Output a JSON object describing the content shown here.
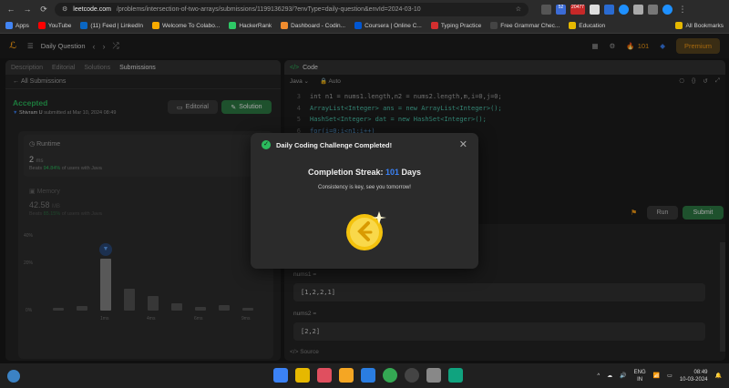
{
  "browser": {
    "url_host": "leetcode.com",
    "url_path": "/problems/intersection-of-two-arrays/submissions/1199136293/?envType=daily-question&envId=2024-03-10",
    "bookmarks": [
      {
        "label": "Apps",
        "color": "#4285f4"
      },
      {
        "label": "YouTube",
        "color": "#ff0000"
      },
      {
        "label": "(11) Feed | LinkedIn",
        "color": "#0a66c2"
      },
      {
        "label": "Welcome To Colabo...",
        "color": "#f9ab00"
      },
      {
        "label": "HackerRank",
        "color": "#2ec866"
      },
      {
        "label": "Dashboard - Codin...",
        "color": "#f08c2e"
      },
      {
        "label": "Coursera | Online C...",
        "color": "#0056d2"
      },
      {
        "label": "Typing Practice",
        "color": "#d32f2f"
      },
      {
        "label": "Free Grammar Chec...",
        "color": "#444444"
      },
      {
        "label": "Education",
        "color": "#e6b800"
      }
    ],
    "all_bookmarks": "All Bookmarks",
    "badges": [
      "52",
      "20477"
    ]
  },
  "appbar": {
    "title": "Daily Question",
    "streak_count": "101",
    "premium": "Premium"
  },
  "left": {
    "tabs": [
      "Description",
      "Editorial",
      "Solutions",
      "Submissions"
    ],
    "back_label": "All Submissions",
    "status": "Accepted",
    "submitter": "Shivram U",
    "submitted_at": "submitted at Mar 10, 2024 08:49",
    "editorial_btn": "Editorial",
    "solution_btn": "Solution",
    "runtime_label": "Runtime",
    "runtime_value": "2",
    "runtime_unit": "ms",
    "runtime_beats_pct": "94.84%",
    "runtime_beats_suffix": "of users with Java",
    "memory_label": "Memory",
    "memory_value": "42.58",
    "memory_unit": "MB",
    "memory_beats_pct": "85.15%",
    "memory_beats_suffix": "of users with Java",
    "chart_y_labels": [
      "40%",
      "20%",
      "0%"
    ],
    "chart_x_labels": [
      "1ms",
      "4ms",
      "6ms",
      "9ms"
    ],
    "minimap_labels": [
      "1ms",
      "6ms"
    ]
  },
  "right": {
    "code_tab": "Code",
    "language": "Java",
    "mode": "Auto",
    "code_lines": [
      {
        "n": "3",
        "text": "int n1 = nums1.length,n2 = nums2.length,m,i=0,j=0;"
      },
      {
        "n": "4",
        "text": "ArrayList<Integer> ans = new ArrayList<Integer>();"
      },
      {
        "n": "5",
        "text": "HashSet<Integer> dat = new HashSet<Integer>();"
      },
      {
        "n": "6",
        "text": "for(i=0;i<n1;i++)"
      }
    ],
    "run": "Run",
    "submit": "Submit",
    "nums1_label": "nums1 =",
    "nums1_value": "[1,2,2,1]",
    "nums2_label": "nums2 =",
    "nums2_value": "[2,2]",
    "source": "Source"
  },
  "modal": {
    "title": "Daily Coding Challenge Completed!",
    "streak_prefix": "Completion Streak:",
    "streak_days": "101",
    "streak_suffix": "Days",
    "message": "Consistency is key, see you tomorrow!"
  },
  "taskbar": {
    "lang_top": "ENG",
    "lang_bottom": "IN",
    "time": "08:49",
    "date": "10-03-2024"
  }
}
